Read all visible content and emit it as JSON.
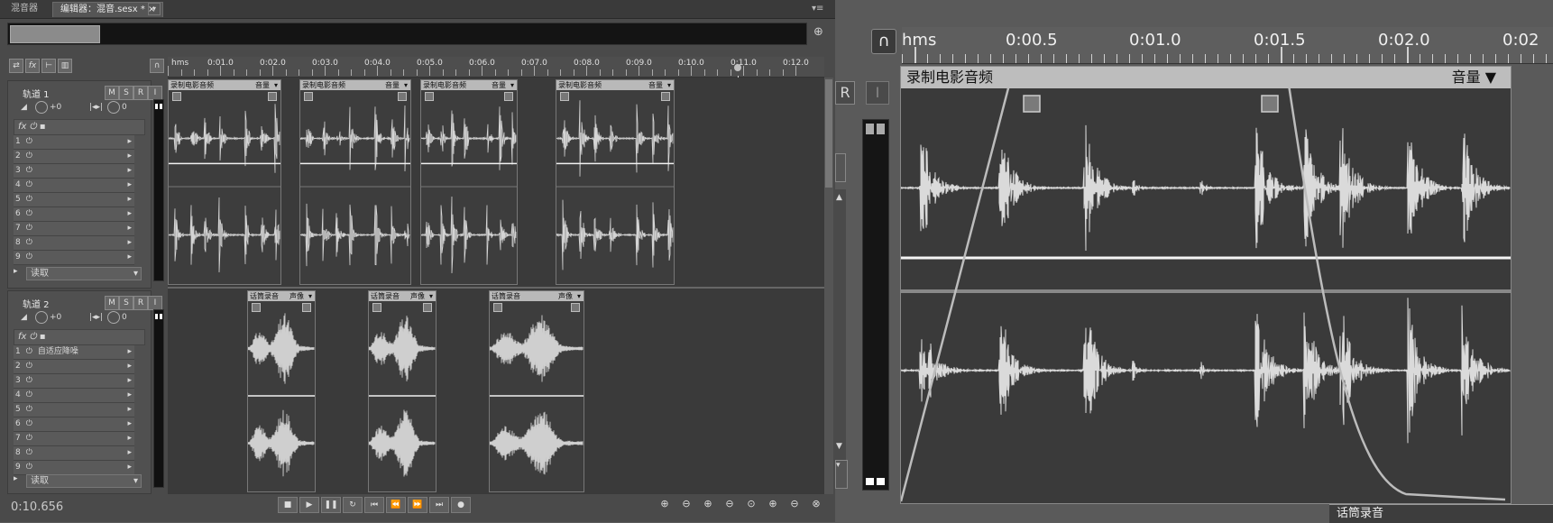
{
  "tabs": [
    {
      "label": "混音器"
    },
    {
      "label": "编辑器：混音.sesx *"
    }
  ],
  "overview": {
    "thumb_label": "..."
  },
  "time_display": "0:10.656",
  "ruler": {
    "unit": "hms",
    "labels": [
      "0:01.0",
      "0:02.0",
      "0:03.0",
      "0:04.0",
      "0:05.0",
      "0:06.0",
      "0:07.0",
      "0:08.0",
      "0:09.0",
      "0:10.0",
      "0:11.0",
      "0:12.0"
    ]
  },
  "tracks": [
    {
      "name": "轨道 1",
      "volume": "+0",
      "pan": "0",
      "buttons": [
        "M",
        "S",
        "R",
        "I"
      ],
      "effects": [
        {
          "num": "1",
          "name": ""
        },
        {
          "num": "2",
          "name": ""
        },
        {
          "num": "3",
          "name": ""
        },
        {
          "num": "4",
          "name": ""
        },
        {
          "num": "5",
          "name": ""
        },
        {
          "num": "6",
          "name": ""
        },
        {
          "num": "7",
          "name": ""
        },
        {
          "num": "8",
          "name": ""
        },
        {
          "num": "9",
          "name": ""
        }
      ],
      "read_mode": "读取",
      "clips": [
        {
          "name": "录制电影音频",
          "param": "音量"
        },
        {
          "name": "录制电影音频",
          "param": "音量"
        },
        {
          "name": "录制电影音频",
          "param": "音量"
        },
        {
          "name": "录制电影音频",
          "param": "音量"
        }
      ]
    },
    {
      "name": "轨道 2",
      "volume": "+0",
      "pan": "0",
      "buttons": [
        "M",
        "S",
        "R",
        "I"
      ],
      "effects": [
        {
          "num": "1",
          "name": "自适应降噪"
        },
        {
          "num": "2",
          "name": ""
        },
        {
          "num": "3",
          "name": ""
        },
        {
          "num": "4",
          "name": ""
        },
        {
          "num": "5",
          "name": ""
        },
        {
          "num": "6",
          "name": ""
        },
        {
          "num": "7",
          "name": ""
        },
        {
          "num": "8",
          "name": ""
        },
        {
          "num": "9",
          "name": ""
        }
      ],
      "read_mode": "读取",
      "clips": [
        {
          "name": "话筒录音",
          "param": "声像"
        },
        {
          "name": "话筒录音",
          "param": "声像"
        },
        {
          "name": "话筒录音",
          "param": "声像"
        }
      ]
    }
  ],
  "zoom": {
    "unit": "hms",
    "labels": [
      "0:00.5",
      "0:01.0",
      "0:01.5",
      "0:02.0",
      "0:02"
    ],
    "clip_name": "录制电影音频",
    "clip_param": "音量",
    "bottom_clip_name": "话筒录音",
    "side_buttons": [
      "R",
      "I"
    ]
  },
  "icons": [
    "magnet-icon",
    "zoom-icon",
    "play-icon",
    "stop-icon",
    "pause-icon",
    "loop-icon",
    "rewind-icon",
    "forward-icon",
    "skip-start-icon",
    "skip-end-icon",
    "record-icon"
  ]
}
